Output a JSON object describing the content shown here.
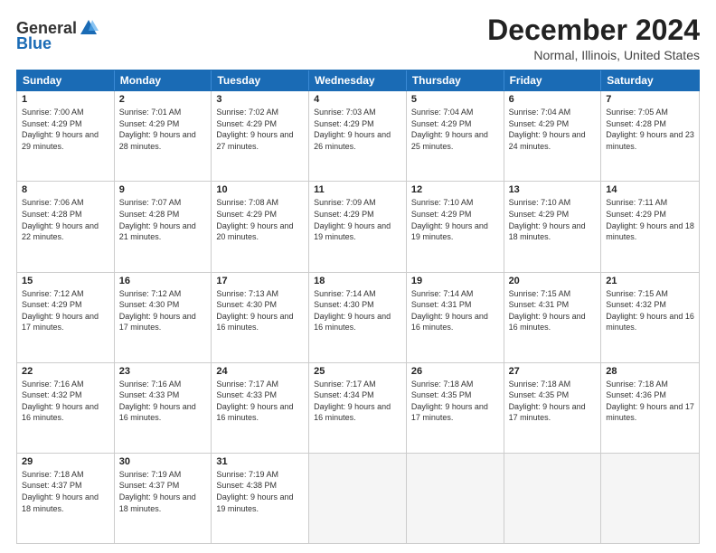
{
  "logo": {
    "general": "General",
    "blue": "Blue"
  },
  "title": "December 2024",
  "subtitle": "Normal, Illinois, United States",
  "headers": [
    "Sunday",
    "Monday",
    "Tuesday",
    "Wednesday",
    "Thursday",
    "Friday",
    "Saturday"
  ],
  "weeks": [
    [
      {
        "day": "1",
        "sunrise": "7:00 AM",
        "sunset": "4:29 PM",
        "daylight": "9 hours and 29 minutes."
      },
      {
        "day": "2",
        "sunrise": "7:01 AM",
        "sunset": "4:29 PM",
        "daylight": "9 hours and 28 minutes."
      },
      {
        "day": "3",
        "sunrise": "7:02 AM",
        "sunset": "4:29 PM",
        "daylight": "9 hours and 27 minutes."
      },
      {
        "day": "4",
        "sunrise": "7:03 AM",
        "sunset": "4:29 PM",
        "daylight": "9 hours and 26 minutes."
      },
      {
        "day": "5",
        "sunrise": "7:04 AM",
        "sunset": "4:29 PM",
        "daylight": "9 hours and 25 minutes."
      },
      {
        "day": "6",
        "sunrise": "7:04 AM",
        "sunset": "4:29 PM",
        "daylight": "9 hours and 24 minutes."
      },
      {
        "day": "7",
        "sunrise": "7:05 AM",
        "sunset": "4:28 PM",
        "daylight": "9 hours and 23 minutes."
      }
    ],
    [
      {
        "day": "8",
        "sunrise": "7:06 AM",
        "sunset": "4:28 PM",
        "daylight": "9 hours and 22 minutes."
      },
      {
        "day": "9",
        "sunrise": "7:07 AM",
        "sunset": "4:28 PM",
        "daylight": "9 hours and 21 minutes."
      },
      {
        "day": "10",
        "sunrise": "7:08 AM",
        "sunset": "4:29 PM",
        "daylight": "9 hours and 20 minutes."
      },
      {
        "day": "11",
        "sunrise": "7:09 AM",
        "sunset": "4:29 PM",
        "daylight": "9 hours and 19 minutes."
      },
      {
        "day": "12",
        "sunrise": "7:10 AM",
        "sunset": "4:29 PM",
        "daylight": "9 hours and 19 minutes."
      },
      {
        "day": "13",
        "sunrise": "7:10 AM",
        "sunset": "4:29 PM",
        "daylight": "9 hours and 18 minutes."
      },
      {
        "day": "14",
        "sunrise": "7:11 AM",
        "sunset": "4:29 PM",
        "daylight": "9 hours and 18 minutes."
      }
    ],
    [
      {
        "day": "15",
        "sunrise": "7:12 AM",
        "sunset": "4:29 PM",
        "daylight": "9 hours and 17 minutes."
      },
      {
        "day": "16",
        "sunrise": "7:12 AM",
        "sunset": "4:30 PM",
        "daylight": "9 hours and 17 minutes."
      },
      {
        "day": "17",
        "sunrise": "7:13 AM",
        "sunset": "4:30 PM",
        "daylight": "9 hours and 16 minutes."
      },
      {
        "day": "18",
        "sunrise": "7:14 AM",
        "sunset": "4:30 PM",
        "daylight": "9 hours and 16 minutes."
      },
      {
        "day": "19",
        "sunrise": "7:14 AM",
        "sunset": "4:31 PM",
        "daylight": "9 hours and 16 minutes."
      },
      {
        "day": "20",
        "sunrise": "7:15 AM",
        "sunset": "4:31 PM",
        "daylight": "9 hours and 16 minutes."
      },
      {
        "day": "21",
        "sunrise": "7:15 AM",
        "sunset": "4:32 PM",
        "daylight": "9 hours and 16 minutes."
      }
    ],
    [
      {
        "day": "22",
        "sunrise": "7:16 AM",
        "sunset": "4:32 PM",
        "daylight": "9 hours and 16 minutes."
      },
      {
        "day": "23",
        "sunrise": "7:16 AM",
        "sunset": "4:33 PM",
        "daylight": "9 hours and 16 minutes."
      },
      {
        "day": "24",
        "sunrise": "7:17 AM",
        "sunset": "4:33 PM",
        "daylight": "9 hours and 16 minutes."
      },
      {
        "day": "25",
        "sunrise": "7:17 AM",
        "sunset": "4:34 PM",
        "daylight": "9 hours and 16 minutes."
      },
      {
        "day": "26",
        "sunrise": "7:18 AM",
        "sunset": "4:35 PM",
        "daylight": "9 hours and 17 minutes."
      },
      {
        "day": "27",
        "sunrise": "7:18 AM",
        "sunset": "4:35 PM",
        "daylight": "9 hours and 17 minutes."
      },
      {
        "day": "28",
        "sunrise": "7:18 AM",
        "sunset": "4:36 PM",
        "daylight": "9 hours and 17 minutes."
      }
    ],
    [
      {
        "day": "29",
        "sunrise": "7:18 AM",
        "sunset": "4:37 PM",
        "daylight": "9 hours and 18 minutes."
      },
      {
        "day": "30",
        "sunrise": "7:19 AM",
        "sunset": "4:37 PM",
        "daylight": "9 hours and 18 minutes."
      },
      {
        "day": "31",
        "sunrise": "7:19 AM",
        "sunset": "4:38 PM",
        "daylight": "9 hours and 19 minutes."
      },
      null,
      null,
      null,
      null
    ]
  ],
  "labels": {
    "sunrise": "Sunrise:",
    "sunset": "Sunset:",
    "daylight": "Daylight:"
  }
}
